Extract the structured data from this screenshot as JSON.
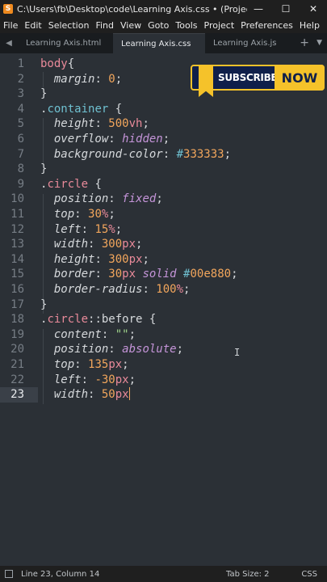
{
  "window": {
    "title": "C:\\Users\\fb\\Desktop\\code\\Learning Axis.css • (Project) - Sub...",
    "app_icon_letter": "S",
    "minimize": "—",
    "maximize": "☐",
    "close": "✕"
  },
  "menu": [
    "File",
    "Edit",
    "Selection",
    "Find",
    "View",
    "Goto",
    "Tools",
    "Project",
    "Preferences",
    "Help"
  ],
  "tabs": {
    "nav_left": "◀",
    "items": [
      {
        "label": "Learning Axis.html"
      },
      {
        "label": "Learning Axis.css"
      },
      {
        "label": "Learning Axis.js"
      }
    ],
    "plus": "+",
    "dropdown": "▼"
  },
  "editor": {
    "current_line": 23,
    "lines": [
      {
        "num": "1",
        "tokens": [
          {
            "t": "body",
            "c": "t-sel"
          },
          {
            "t": "{",
            "c": "t-punc"
          }
        ]
      },
      {
        "num": "2",
        "tokens": [
          {
            "t": "  ",
            "c": "t-punc"
          },
          {
            "t": "margin",
            "c": "t-prop"
          },
          {
            "t": ": ",
            "c": "t-punc"
          },
          {
            "t": "0",
            "c": "t-num"
          },
          {
            "t": ";",
            "c": "t-punc"
          }
        ]
      },
      {
        "num": "3",
        "tokens": [
          {
            "t": "}",
            "c": "t-punc"
          }
        ]
      },
      {
        "num": "4",
        "tokens": [
          {
            "t": ".",
            "c": "t-punc"
          },
          {
            "t": "container",
            "c": "t-cls"
          },
          {
            "t": " {",
            "c": "t-punc"
          }
        ]
      },
      {
        "num": "5",
        "tokens": [
          {
            "t": "  ",
            "c": "t-punc"
          },
          {
            "t": "height",
            "c": "t-prop"
          },
          {
            "t": ": ",
            "c": "t-punc"
          },
          {
            "t": "500",
            "c": "t-num"
          },
          {
            "t": "vh",
            "c": "t-unit"
          },
          {
            "t": ";",
            "c": "t-punc"
          }
        ]
      },
      {
        "num": "6",
        "tokens": [
          {
            "t": "  ",
            "c": "t-punc"
          },
          {
            "t": "overflow",
            "c": "t-prop"
          },
          {
            "t": ": ",
            "c": "t-punc"
          },
          {
            "t": "hidden",
            "c": "t-kw"
          },
          {
            "t": ";",
            "c": "t-punc"
          }
        ]
      },
      {
        "num": "7",
        "tokens": [
          {
            "t": "  ",
            "c": "t-punc"
          },
          {
            "t": "background-color",
            "c": "t-prop"
          },
          {
            "t": ": ",
            "c": "t-punc"
          },
          {
            "t": "#",
            "c": "t-hash"
          },
          {
            "t": "333333",
            "c": "t-num"
          },
          {
            "t": ";",
            "c": "t-punc"
          }
        ]
      },
      {
        "num": "8",
        "tokens": [
          {
            "t": "}",
            "c": "t-punc"
          }
        ]
      },
      {
        "num": "9",
        "tokens": [
          {
            "t": ".",
            "c": "t-punc"
          },
          {
            "t": "circle",
            "c": "t-sel"
          },
          {
            "t": " {",
            "c": "t-punc"
          }
        ]
      },
      {
        "num": "10",
        "tokens": [
          {
            "t": "  ",
            "c": "t-punc"
          },
          {
            "t": "position",
            "c": "t-prop"
          },
          {
            "t": ": ",
            "c": "t-punc"
          },
          {
            "t": "fixed",
            "c": "t-kw"
          },
          {
            "t": ";",
            "c": "t-punc"
          }
        ]
      },
      {
        "num": "11",
        "tokens": [
          {
            "t": "  ",
            "c": "t-punc"
          },
          {
            "t": "top",
            "c": "t-prop"
          },
          {
            "t": ": ",
            "c": "t-punc"
          },
          {
            "t": "30",
            "c": "t-num"
          },
          {
            "t": "%",
            "c": "t-unit"
          },
          {
            "t": ";",
            "c": "t-punc"
          }
        ]
      },
      {
        "num": "12",
        "tokens": [
          {
            "t": "  ",
            "c": "t-punc"
          },
          {
            "t": "left",
            "c": "t-prop"
          },
          {
            "t": ": ",
            "c": "t-punc"
          },
          {
            "t": "15",
            "c": "t-num"
          },
          {
            "t": "%",
            "c": "t-unit"
          },
          {
            "t": ";",
            "c": "t-punc"
          }
        ]
      },
      {
        "num": "13",
        "tokens": [
          {
            "t": "  ",
            "c": "t-punc"
          },
          {
            "t": "width",
            "c": "t-prop"
          },
          {
            "t": ": ",
            "c": "t-punc"
          },
          {
            "t": "300",
            "c": "t-num"
          },
          {
            "t": "px",
            "c": "t-unit"
          },
          {
            "t": ";",
            "c": "t-punc"
          }
        ]
      },
      {
        "num": "14",
        "tokens": [
          {
            "t": "  ",
            "c": "t-punc"
          },
          {
            "t": "height",
            "c": "t-prop"
          },
          {
            "t": ": ",
            "c": "t-punc"
          },
          {
            "t": "300",
            "c": "t-num"
          },
          {
            "t": "px",
            "c": "t-unit"
          },
          {
            "t": ";",
            "c": "t-punc"
          }
        ]
      },
      {
        "num": "15",
        "tokens": [
          {
            "t": "  ",
            "c": "t-punc"
          },
          {
            "t": "border",
            "c": "t-prop"
          },
          {
            "t": ": ",
            "c": "t-punc"
          },
          {
            "t": "30",
            "c": "t-num"
          },
          {
            "t": "px",
            "c": "t-unit"
          },
          {
            "t": " ",
            "c": "t-punc"
          },
          {
            "t": "solid",
            "c": "t-kw"
          },
          {
            "t": " ",
            "c": "t-punc"
          },
          {
            "t": "#",
            "c": "t-hash"
          },
          {
            "t": "00e880",
            "c": "t-num"
          },
          {
            "t": ";",
            "c": "t-punc"
          }
        ]
      },
      {
        "num": "16",
        "tokens": [
          {
            "t": "  ",
            "c": "t-punc"
          },
          {
            "t": "border-radius",
            "c": "t-prop"
          },
          {
            "t": ": ",
            "c": "t-punc"
          },
          {
            "t": "100",
            "c": "t-num"
          },
          {
            "t": "%",
            "c": "t-unit"
          },
          {
            "t": ";",
            "c": "t-punc"
          }
        ]
      },
      {
        "num": "17",
        "tokens": [
          {
            "t": "}",
            "c": "t-punc"
          }
        ]
      },
      {
        "num": "18",
        "tokens": [
          {
            "t": ".",
            "c": "t-punc"
          },
          {
            "t": "circle",
            "c": "t-sel"
          },
          {
            "t": "::",
            "c": "t-punc"
          },
          {
            "t": "before",
            "c": "t-punc"
          },
          {
            "t": " {",
            "c": "t-punc"
          }
        ]
      },
      {
        "num": "19",
        "tokens": [
          {
            "t": "  ",
            "c": "t-punc"
          },
          {
            "t": "content",
            "c": "t-prop"
          },
          {
            "t": ": ",
            "c": "t-punc"
          },
          {
            "t": "\"\"",
            "c": "t-str"
          },
          {
            "t": ";",
            "c": "t-punc"
          }
        ]
      },
      {
        "num": "20",
        "tokens": [
          {
            "t": "  ",
            "c": "t-punc"
          },
          {
            "t": "position",
            "c": "t-prop"
          },
          {
            "t": ": ",
            "c": "t-punc"
          },
          {
            "t": "absolute",
            "c": "t-kw"
          },
          {
            "t": ";",
            "c": "t-punc"
          }
        ]
      },
      {
        "num": "21",
        "tokens": [
          {
            "t": "  ",
            "c": "t-punc"
          },
          {
            "t": "top",
            "c": "t-prop"
          },
          {
            "t": ": ",
            "c": "t-punc"
          },
          {
            "t": "135",
            "c": "t-num"
          },
          {
            "t": "px",
            "c": "t-unit"
          },
          {
            "t": ";",
            "c": "t-punc"
          }
        ]
      },
      {
        "num": "22",
        "tokens": [
          {
            "t": "  ",
            "c": "t-punc"
          },
          {
            "t": "left",
            "c": "t-prop"
          },
          {
            "t": ": ",
            "c": "t-punc"
          },
          {
            "t": "-30",
            "c": "t-num"
          },
          {
            "t": "px",
            "c": "t-unit"
          },
          {
            "t": ";",
            "c": "t-punc"
          }
        ]
      },
      {
        "num": "23",
        "tokens": [
          {
            "t": "  ",
            "c": "t-punc"
          },
          {
            "t": "width",
            "c": "t-prop"
          },
          {
            "t": ": ",
            "c": "t-punc"
          },
          {
            "t": "50",
            "c": "t-num"
          },
          {
            "t": "px",
            "c": "t-unit"
          }
        ]
      }
    ]
  },
  "subscribe": {
    "label": "SUBSCRIBE",
    "now": "NOW"
  },
  "status": {
    "position": "Line 23, Column 14",
    "tab_size": "Tab Size: 2",
    "syntax": "CSS"
  },
  "colors": {
    "background": "#2b3036",
    "selector": "#e98a9a",
    "class": "#6fc0d0",
    "number": "#f2a65c",
    "keyword": "#c494d8",
    "string": "#9fd38a"
  }
}
